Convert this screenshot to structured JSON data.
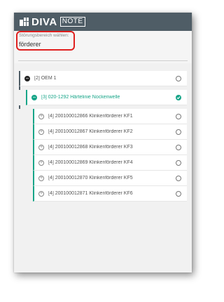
{
  "header": {
    "brand": "DIVA",
    "brand_sub": "NOTE",
    "brand_color": "#4f5d66"
  },
  "search": {
    "label": "Störungsbereich wählen:",
    "value": "förderer"
  },
  "tree": {
    "accent_color": "#17a588",
    "root": {
      "label": "[2]  OEM 1"
    },
    "group": {
      "label": "[3]  020-1292 Härtelinie Nockenwelle"
    },
    "items": [
      {
        "label": "[4]  200100012866 Klinkenförderer KF1"
      },
      {
        "label": "[4]  200100012867 Klinkenförderer KF2"
      },
      {
        "label": "[4]  200100012868 Klinkenförderer KF3"
      },
      {
        "label": "[4]  200100012869 Klinkenförderer KF4"
      },
      {
        "label": "[4]  200100012870 Klinkenförderer KF5"
      },
      {
        "label": "[4]  200100012871 Klinkenförderer KF6"
      }
    ]
  }
}
